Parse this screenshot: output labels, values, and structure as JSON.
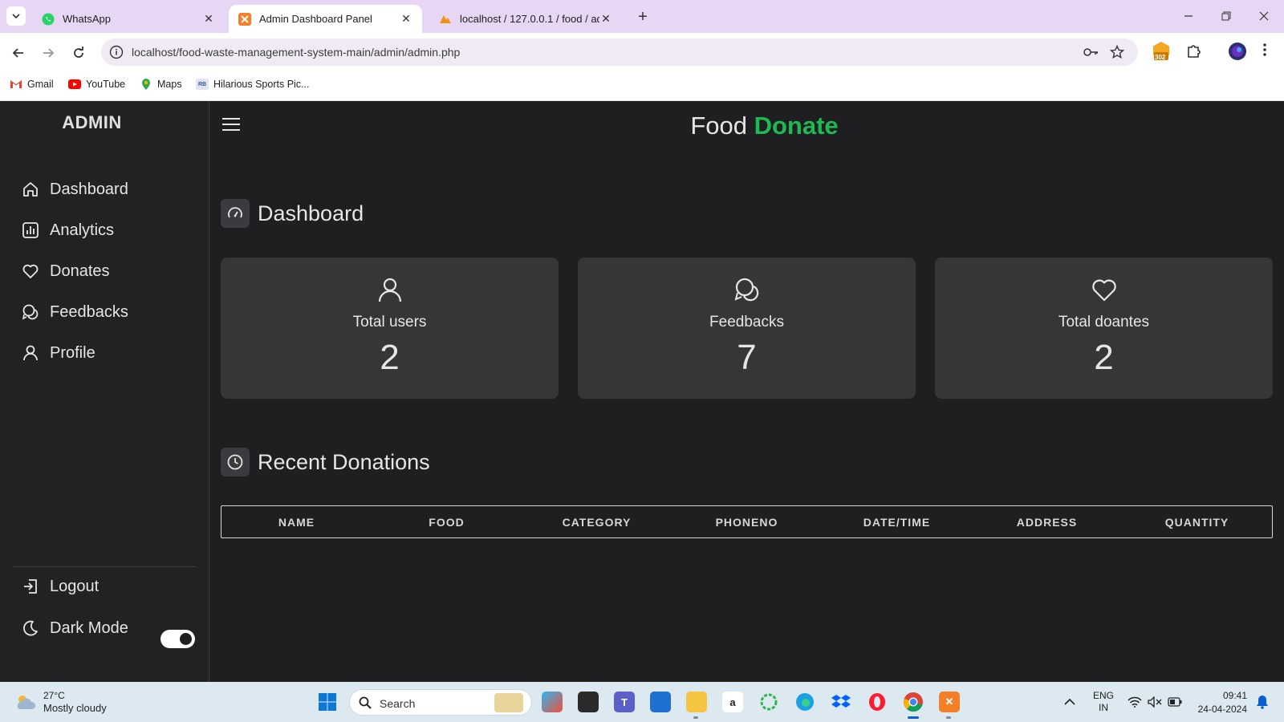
{
  "browser": {
    "tabs": [
      {
        "title": "WhatsApp",
        "active": false
      },
      {
        "title": "Admin Dashboard Panel",
        "active": true
      },
      {
        "title": "localhost / 127.0.0.1 / food / ad",
        "active": false
      }
    ],
    "url": "localhost/food-waste-management-system-main/admin/admin.php",
    "extension_badge": "302",
    "bookmarks": [
      "Gmail",
      "YouTube",
      "Maps",
      "Hilarious Sports Pic..."
    ],
    "bookmark_icon_text": "RB"
  },
  "sidebar": {
    "brand": "ADMIN",
    "items": [
      {
        "label": "Dashboard",
        "icon": "home-icon"
      },
      {
        "label": "Analytics",
        "icon": "bar-chart-icon"
      },
      {
        "label": "Donates",
        "icon": "heart-icon"
      },
      {
        "label": "Feedbacks",
        "icon": "chat-icon"
      },
      {
        "label": "Profile",
        "icon": "user-icon"
      }
    ],
    "logout": "Logout",
    "dark_mode": "Dark Mode",
    "dark_mode_on": true
  },
  "header": {
    "title_part1": "Food",
    "title_part2": "Donate",
    "accent_color": "#1fb954"
  },
  "dashboard": {
    "heading": "Dashboard",
    "cards": [
      {
        "label": "Total users",
        "value": "2",
        "icon": "user-icon"
      },
      {
        "label": "Feedbacks",
        "value": "7",
        "icon": "chat-icon"
      },
      {
        "label": "Total doantes",
        "value": "2",
        "icon": "heart-icon"
      }
    ]
  },
  "recent": {
    "heading": "Recent Donations",
    "columns": [
      "NAME",
      "FOOD",
      "CATEGORY",
      "PHONENO",
      "DATE/TIME",
      "ADDRESS",
      "QUANTITY"
    ]
  },
  "taskbar": {
    "weather_temp": "27°C",
    "weather_cond": "Mostly cloudy",
    "search_placeholder": "Search",
    "lang_line1": "ENG",
    "lang_line2": "IN",
    "time": "09:41",
    "date": "24-04-2024"
  }
}
